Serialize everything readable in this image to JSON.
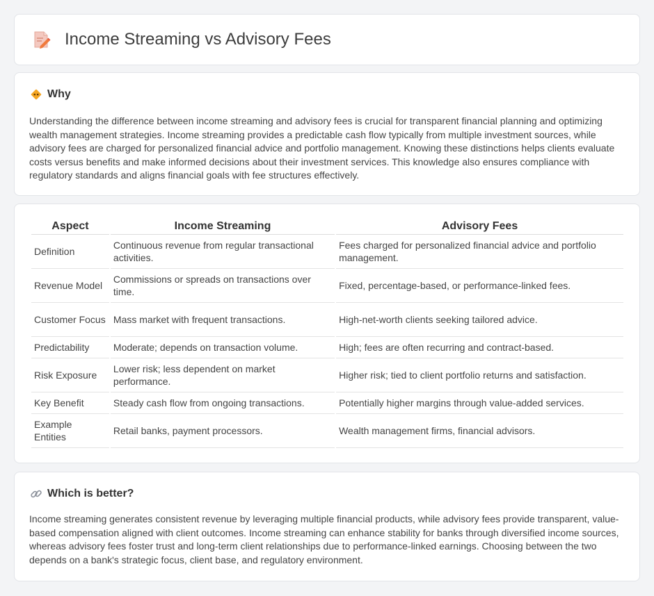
{
  "header": {
    "title": "Income Streaming vs Advisory Fees",
    "icon": "document-pen-icon"
  },
  "why": {
    "icon": "diamond-sign-icon",
    "title": "Why",
    "text": "Understanding the difference between income streaming and advisory fees is crucial for transparent financial planning and optimizing wealth management strategies. Income streaming provides a predictable cash flow typically from multiple investment sources, while advisory fees are charged for personalized financial advice and portfolio management. Knowing these distinctions helps clients evaluate costs versus benefits and make informed decisions about their investment services. This knowledge also ensures compliance with regulatory standards and aligns financial goals with fee structures effectively."
  },
  "table": {
    "headers": [
      "Aspect",
      "Income Streaming",
      "Advisory Fees"
    ],
    "rows": [
      [
        "Definition",
        "Continuous revenue from regular transactional activities.",
        "Fees charged for personalized financial advice and portfolio management."
      ],
      [
        "Revenue Model",
        "Commissions or spreads on transactions over time.",
        "Fixed, percentage-based, or performance-linked fees."
      ],
      [
        "Customer Focus",
        "Mass market with frequent transactions.",
        "High-net-worth clients seeking tailored advice."
      ],
      [
        "Predictability",
        "Moderate; depends on transaction volume.",
        "High; fees are often recurring and contract-based."
      ],
      [
        "Risk Exposure",
        "Lower risk; less dependent on market performance.",
        "Higher risk; tied to client portfolio returns and satisfaction."
      ],
      [
        "Key Benefit",
        "Steady cash flow from ongoing transactions.",
        "Potentially higher margins through value-added services."
      ],
      [
        "Example Entities",
        "Retail banks, payment processors.",
        "Wealth management firms, financial advisors."
      ]
    ]
  },
  "better": {
    "icon": "link-icon",
    "title": "Which is better?",
    "text": "Income streaming generates consistent revenue by leveraging multiple financial products, while advisory fees provide transparent, value-based compensation aligned with client outcomes. Income streaming can enhance stability for banks through diversified income sources, whereas advisory fees foster trust and long-term client relationships due to performance-linked earnings. Choosing between the two depends on a bank's strategic focus, client base, and regulatory environment."
  }
}
